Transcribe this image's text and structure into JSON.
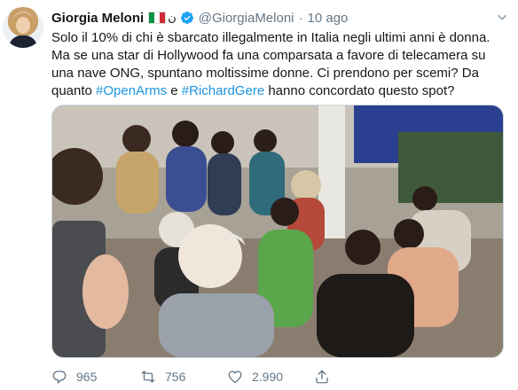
{
  "tweet": {
    "author_name": "Giorgia Meloni",
    "author_glyph": "ن",
    "handle": "@GiorgiaMeloni",
    "separator": "·",
    "time": "10 ago",
    "lines": [
      "Solo il 10% di chi è sbarcato illegalmente in Italia negli ultimi anni è donna.",
      "Ma se una star di Hollywood fa una comparsata a favore di telecamera su",
      "una nave ONG, spuntano moltissime donne. Ci prendono per scemi? Da"
    ],
    "line4_prefix": "quanto ",
    "hashtag1": "#OpenArms",
    "line4_mid": " e ",
    "hashtag2": "#RichardGere",
    "line4_suffix": " hanno concordato questo spot?"
  },
  "actions": {
    "replies": "965",
    "retweets": "756",
    "likes": "2.990"
  },
  "icons": {
    "avatar": "profile-photo",
    "flag": "italian-flag",
    "verified": "verified-badge-icon",
    "caret": "chevron-down-icon",
    "reply": "reply-icon",
    "retweet": "retweet-icon",
    "like": "heart-icon",
    "share": "share-icon"
  },
  "colors": {
    "link": "#1b95e0",
    "muted": "#657786",
    "text": "#14171a",
    "flag_green": "#009246",
    "flag_white": "#ffffff",
    "flag_red": "#ce2b37"
  }
}
